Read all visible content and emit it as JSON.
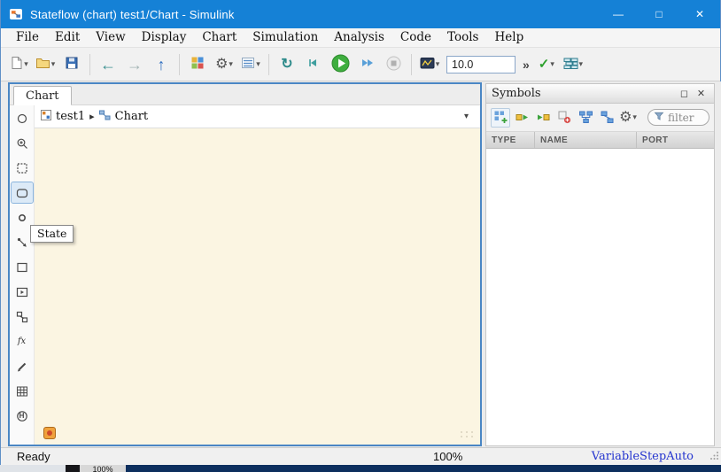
{
  "window": {
    "title": "Stateflow (chart) test1/Chart - Simulink"
  },
  "menu": {
    "items": [
      "File",
      "Edit",
      "View",
      "Display",
      "Chart",
      "Simulation",
      "Analysis",
      "Code",
      "Tools",
      "Help"
    ]
  },
  "toolbar": {
    "sim_stop_time": "10.0",
    "overflow": "»"
  },
  "editor": {
    "tab": "Chart",
    "breadcrumb": {
      "model": "test1",
      "separator": "▸",
      "chart": "Chart"
    },
    "tooltip": "State"
  },
  "symbols": {
    "title": "Symbols",
    "filter_placeholder": "filter",
    "columns": [
      "TYPE",
      "NAME",
      "PORT"
    ],
    "rows": []
  },
  "statusbar": {
    "left": "Ready",
    "zoom": "100%",
    "solver": "VariableStepAuto"
  },
  "background": {
    "zoom": "100%"
  },
  "icons": {
    "caret": "▾",
    "back": "←",
    "forward": "→",
    "up": "↑",
    "gear": "⚙",
    "check": "✓",
    "refresh": "↻",
    "minimize": "—",
    "maximize": "□",
    "close": "✕",
    "float": "◻",
    "history": "H",
    "fx": "fx"
  }
}
